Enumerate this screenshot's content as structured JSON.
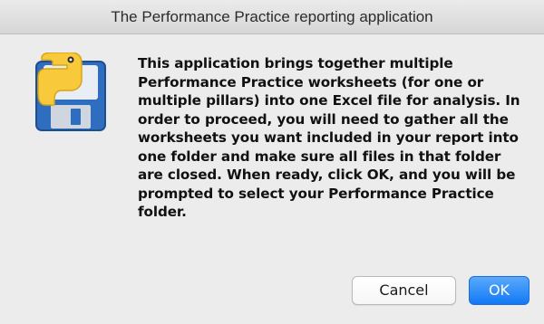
{
  "window": {
    "title": "The Performance Practice reporting application"
  },
  "dialog": {
    "icon": "python-floppy-disk-icon",
    "message": "This application brings together multiple Performance Practice worksheets (for one or multiple pillars) into one Excel file for analysis. In order to proceed, you will need to gather all the worksheets you want included in your report into one folder and make sure all files in that folder are closed. When ready, click OK, and you will be prompted to select your Performance Practice folder."
  },
  "buttons": {
    "cancel_label": "Cancel",
    "ok_label": "OK"
  },
  "colors": {
    "background": "#ececec",
    "accent": "#1179f5",
    "floppy": "#2f6ebe",
    "python_yellow": "#f7c93b"
  }
}
